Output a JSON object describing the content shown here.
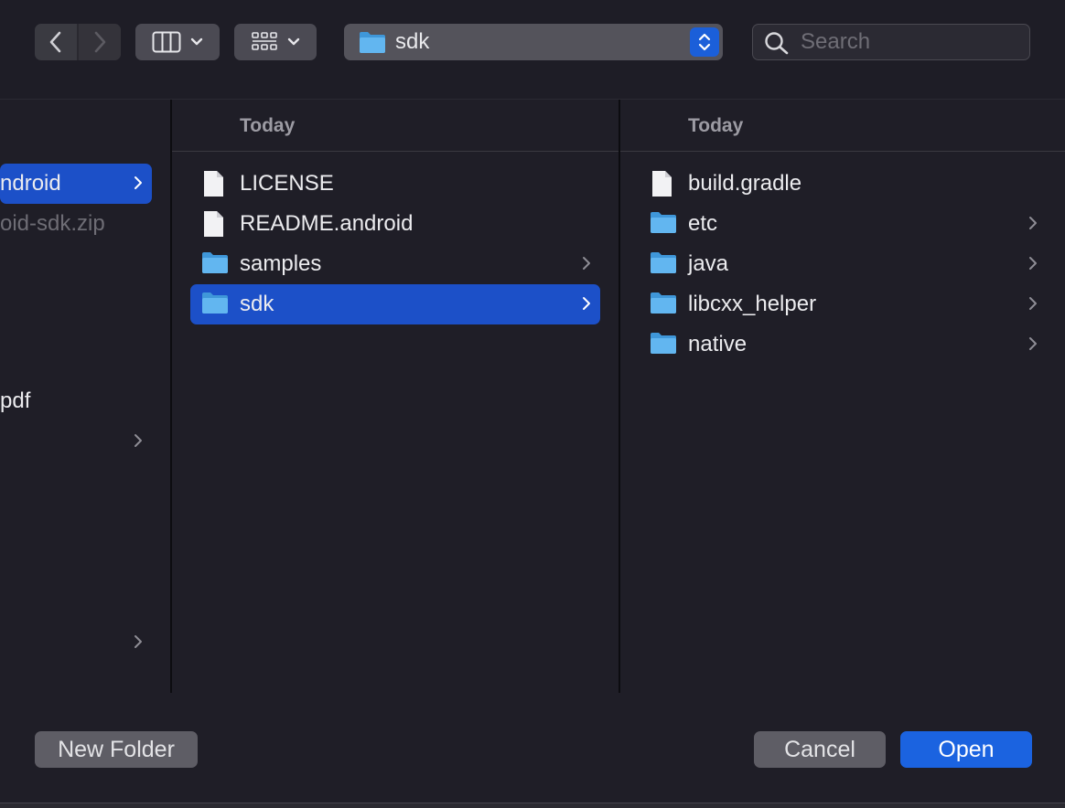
{
  "toolbar": {
    "path_label": "sdk",
    "search_placeholder": "Search"
  },
  "columns": [
    {
      "items": [
        {
          "label": "ndroid",
          "icon": "none",
          "selected": true,
          "chevron": true,
          "dim": false
        },
        {
          "label": "oid-sdk.zip",
          "icon": "none",
          "selected": false,
          "chevron": false,
          "dim": true
        },
        {
          "label": "pdf",
          "icon": "none",
          "selected": false,
          "chevron": false,
          "dim": false
        }
      ]
    },
    {
      "header": "Today",
      "items": [
        {
          "label": "LICENSE",
          "icon": "document-icon",
          "chevron": false,
          "selected": false
        },
        {
          "label": "README.android",
          "icon": "document-icon",
          "chevron": false,
          "selected": false
        },
        {
          "label": "samples",
          "icon": "folder-icon",
          "chevron": true,
          "selected": false
        },
        {
          "label": "sdk",
          "icon": "folder-icon",
          "chevron": true,
          "selected": true
        }
      ]
    },
    {
      "header": "Today",
      "items": [
        {
          "label": "build.gradle",
          "icon": "document-icon",
          "chevron": false
        },
        {
          "label": "etc",
          "icon": "folder-icon",
          "chevron": true
        },
        {
          "label": "java",
          "icon": "folder-icon",
          "chevron": true
        },
        {
          "label": "libcxx_helper",
          "icon": "folder-icon",
          "chevron": true
        },
        {
          "label": "native",
          "icon": "folder-icon",
          "chevron": true
        }
      ]
    }
  ],
  "footer": {
    "new_folder_label": "New Folder",
    "cancel_label": "Cancel",
    "open_label": "Open"
  },
  "colors": {
    "accent": "#1b63e0",
    "selection": "#1c50c8",
    "folder": "#5fb4ee"
  }
}
